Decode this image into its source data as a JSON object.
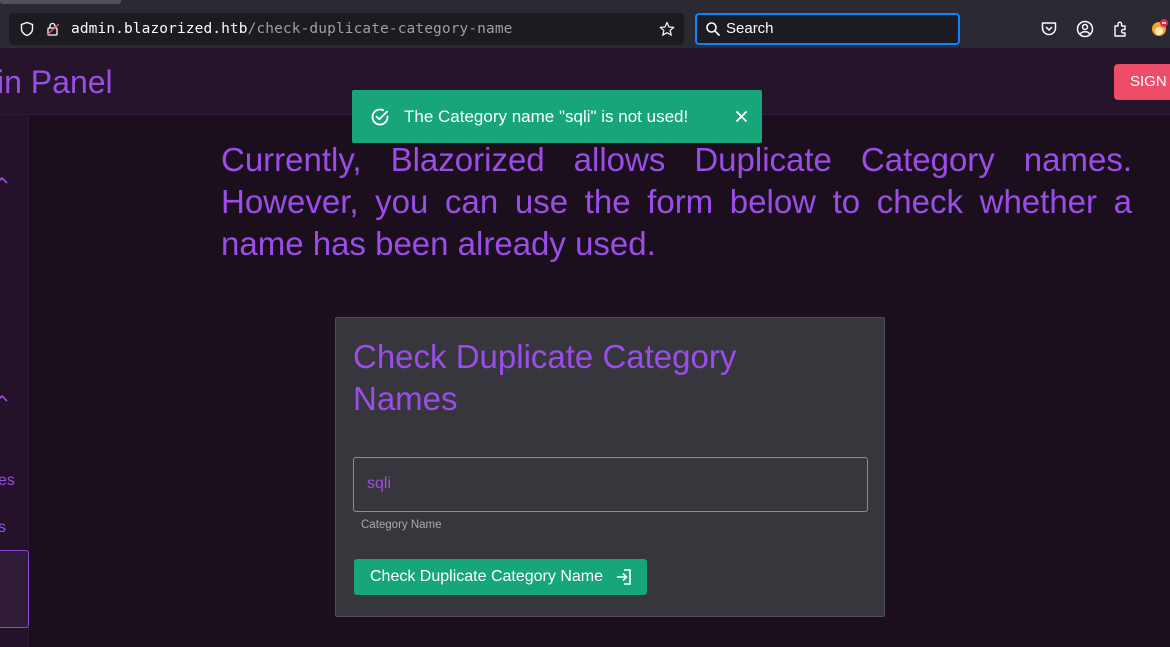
{
  "browser": {
    "url_host": "admin.blazorized.htb",
    "url_path": "/check-duplicate-category-name",
    "search_placeholder": "Search"
  },
  "header": {
    "title": "in Panel",
    "sign_button": "SIGN"
  },
  "sidebar": {
    "labels": [
      "es",
      "s"
    ]
  },
  "toast": {
    "message": "The Category name \"sqli\" is not used!"
  },
  "main": {
    "intro": "Currently, Blazorized allows Duplicate Category names. However, you can use the form below to check whether a name has been already used.",
    "card_title": "Check Duplicate Category Names",
    "input_value": "sqli",
    "input_label": "Category Name",
    "submit_label": "Check Duplicate Category Name"
  },
  "colors": {
    "accent": "#9b4de8",
    "success": "#17a67a",
    "danger": "#ee4d6a"
  }
}
